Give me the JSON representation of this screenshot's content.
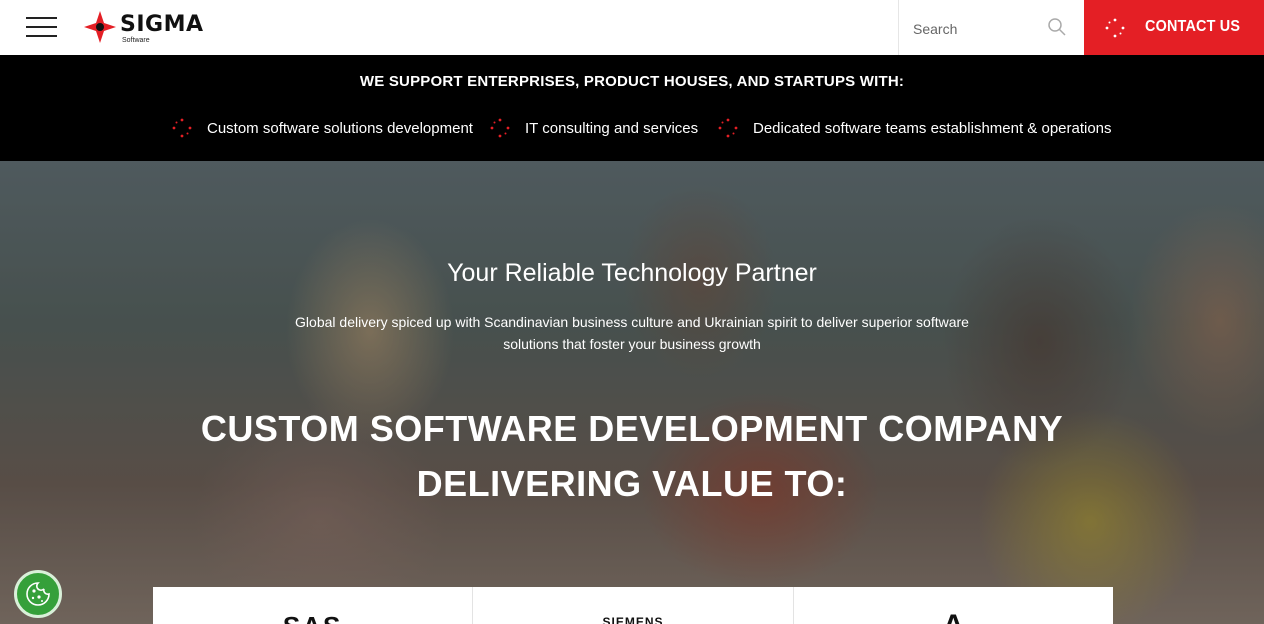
{
  "header": {
    "logo_text": "SIGMA",
    "logo_sub": "Software",
    "search_placeholder": "Search",
    "contact_label": "CONTACT US"
  },
  "strip": {
    "title": "WE SUPPORT ENTERPRISES, PRODUCT HOUSES, AND STARTUPS WITH:",
    "items": [
      {
        "label": "Custom software solutions development"
      },
      {
        "label": "IT consulting and services"
      },
      {
        "label": "Dedicated software teams establishment & operations"
      }
    ]
  },
  "hero": {
    "title": "Your Reliable Technology Partner",
    "subtitle": "Global delivery spiced up with Scandinavian business culture and Ukrainian spirit to deliver superior software solutions that foster your business growth",
    "heading": "CUSTOM SOFTWARE DEVELOPMENT COMPANY DELIVERING VALUE TO:",
    "cards": [
      {
        "label": "SAS"
      },
      {
        "label": "SIEMENS"
      },
      {
        "label": "A"
      }
    ]
  },
  "colors": {
    "brand_red": "#e41f25",
    "cookie_green": "#35a03a"
  },
  "icons": {
    "menu": "hamburger-icon",
    "search": "search-icon",
    "bullet": "sparkle-icon",
    "cookie": "cookie-icon"
  }
}
